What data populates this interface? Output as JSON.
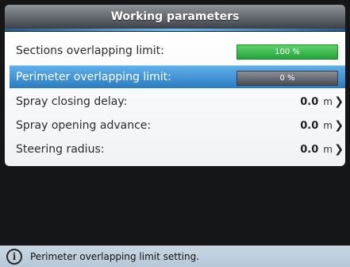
{
  "header": {
    "title": "Working parameters"
  },
  "rows": [
    {
      "label": "Sections overlapping limit:",
      "control": "bar",
      "bar_text": "100 %",
      "bar_color": "#2fb04a"
    },
    {
      "label": "Perimeter overlapping limit:",
      "control": "bar",
      "bar_text": "0 %",
      "bar_color": "#5a5e64",
      "selected": true
    },
    {
      "label": "Spray closing delay:",
      "value": "0.0",
      "unit": "m"
    },
    {
      "label": "Spray opening advance:",
      "value": "0.0",
      "unit": "m"
    },
    {
      "label": "Steering radius:",
      "value": "0.0",
      "unit": "m"
    }
  ],
  "status": {
    "icon": "info-icon",
    "text": "Perimeter overlapping limit setting."
  },
  "colors": {
    "selection": "#3a8fd6",
    "header": "#5a5f66",
    "status_bar": "#bfcfdd"
  }
}
